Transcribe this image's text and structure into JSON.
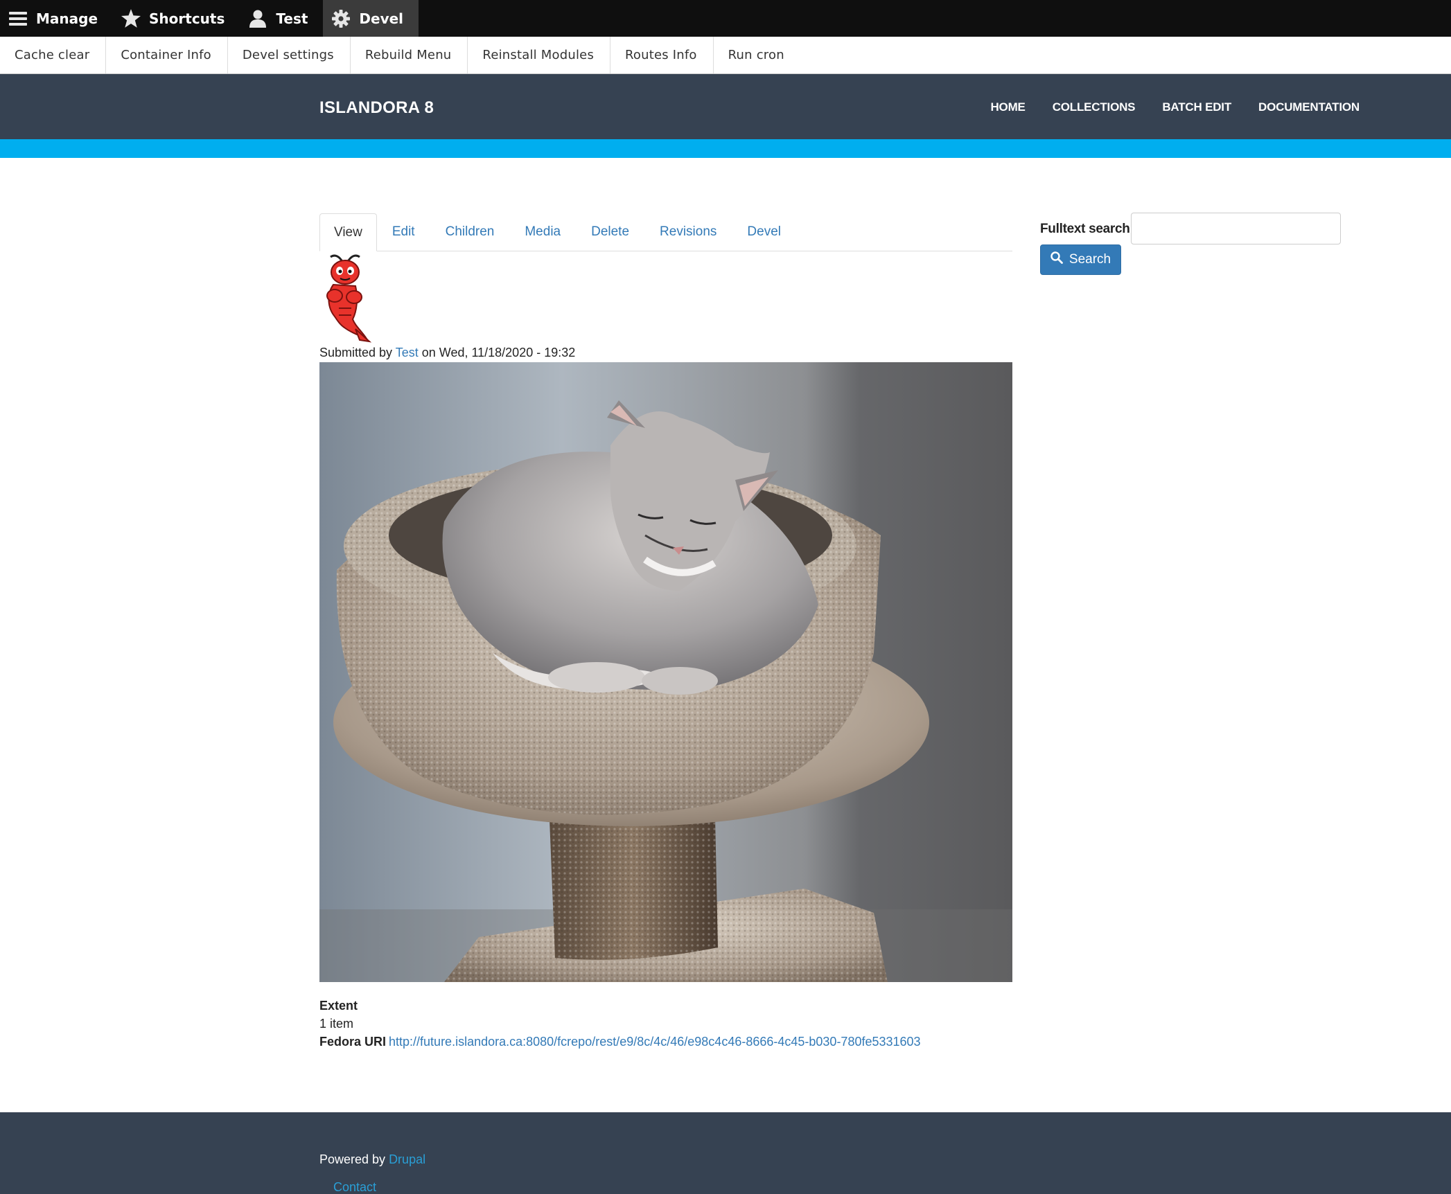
{
  "admin_toolbar": {
    "items": [
      {
        "label": "Manage",
        "icon": "hamburger-icon"
      },
      {
        "label": "Shortcuts",
        "icon": "star-icon"
      },
      {
        "label": "Test",
        "icon": "user-icon"
      },
      {
        "label": "Devel",
        "icon": "gear-icon"
      }
    ],
    "tray": [
      "Cache clear",
      "Container Info",
      "Devel settings",
      "Rebuild Menu",
      "Reinstall Modules",
      "Routes Info",
      "Run cron"
    ]
  },
  "header": {
    "site_name": "ISLANDORA 8",
    "nav": [
      "HOME",
      "COLLECTIONS",
      "BATCH EDIT",
      "DOCUMENTATION"
    ]
  },
  "tabs": [
    "View",
    "Edit",
    "Children",
    "Media",
    "Delete",
    "Revisions",
    "Devel"
  ],
  "node": {
    "submitted_prefix": "Submitted by ",
    "author": "Test",
    "submitted_suffix": " on Wed, 11/18/2020 - 19:32",
    "extent_label": "Extent",
    "extent_value": "1 item",
    "fedora_label": "Fedora URI",
    "fedora_uri": "http://future.islandora.ca:8080/fcrepo/rest/e9/8c/4c/46/e98c4c46-8666-4c45-b030-780fe5331603"
  },
  "sidebar": {
    "search_label": "Fulltext search",
    "search_value": "",
    "search_button": "Search"
  },
  "footer": {
    "powered_prefix": "Powered by ",
    "powered_link": "Drupal",
    "contact": "Contact"
  },
  "colors": {
    "toolbar_bg": "#0f0f0f",
    "header_bg": "#364252",
    "accent_bar": "#00aeef",
    "link": "#337ab7",
    "button": "#337ab7"
  }
}
